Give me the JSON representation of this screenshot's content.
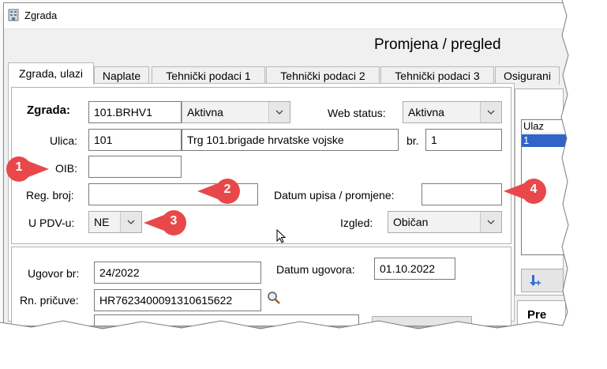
{
  "window": {
    "title": "Zgrada",
    "header": "Promjena / pregled"
  },
  "tabs": [
    {
      "label": "Zgrada, ulazi",
      "active": true
    },
    {
      "label": "Naplate"
    },
    {
      "label": "Tehnički podaci 1"
    },
    {
      "label": "Tehnički podaci 2"
    },
    {
      "label": "Tehnički podaci 3"
    },
    {
      "label": "Osigurani"
    }
  ],
  "building": {
    "zgrada_label": "Zgrada:",
    "zgrada_value": "101.BRHV1",
    "status_value": "Aktivna",
    "web_status_label": "Web status:",
    "web_status_value": "Aktivna",
    "ulica_label": "Ulica:",
    "ulica_code": "101",
    "ulica_name": "Trg 101.brigade hrvatske vojske",
    "br_label": "br.",
    "br_value": "1",
    "oib_label": "OIB:",
    "oib_value": "",
    "reg_label": "Reg. broj:",
    "reg_value": "",
    "datum_upisa_label": "Datum upisa / promjene:",
    "datum_upisa_value": "",
    "pdv_label": "U PDV-u:",
    "pdv_value": "NE",
    "izgled_label": "Izgled:",
    "izgled_value": "Običan"
  },
  "contract": {
    "ugovor_label": "Ugovor br:",
    "ugovor_value": "24/2022",
    "datum_ugovora_label": "Datum ugovora:",
    "datum_ugovora_value": "01.10.2022",
    "rn_label": "Rn. pričuve:",
    "rn_value": "HR7623400091310615622"
  },
  "right_panel": {
    "list_header": "Ulaz",
    "list_items": [
      "1"
    ],
    "bottom_label": "Pre"
  },
  "callouts": [
    "1",
    "2",
    "3",
    "4"
  ],
  "colors": {
    "callout": "#e8484a",
    "selection": "#3064c8"
  }
}
